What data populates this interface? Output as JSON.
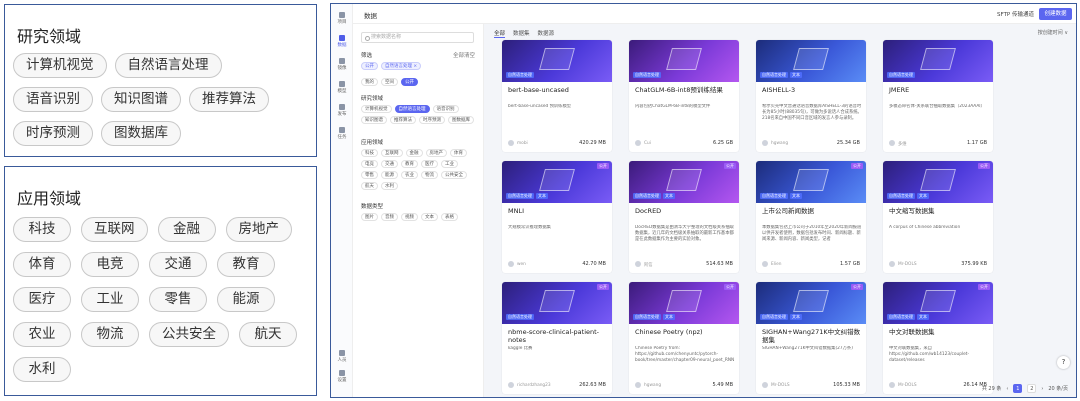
{
  "research": {
    "title": "研究领域",
    "tags": [
      "计算机视觉",
      "自然语言处理",
      "语音识别",
      "知识图谱",
      "推荐算法",
      "时序预测",
      "图数据库"
    ]
  },
  "application": {
    "title": "应用领域",
    "tags": [
      "科技",
      "互联网",
      "金融",
      "房地产",
      "体育",
      "电竞",
      "交通",
      "教育",
      "医疗",
      "工业",
      "零售",
      "能源",
      "农业",
      "物流",
      "公共安全",
      "航天",
      "水利"
    ]
  },
  "app": {
    "rail": [
      {
        "label": "项目",
        "icon": "folder-icon"
      },
      {
        "label": "数据",
        "icon": "database-icon",
        "active": true
      },
      {
        "label": "镜像",
        "icon": "image-icon"
      },
      {
        "label": "模型",
        "icon": "model-icon"
      },
      {
        "label": "发布",
        "icon": "publish-icon"
      },
      {
        "label": "任务",
        "icon": "task-icon"
      }
    ],
    "rail_bottom": [
      {
        "label": "人员",
        "icon": "people-icon"
      },
      {
        "label": "设置",
        "icon": "settings-icon"
      }
    ],
    "header": {
      "title": "数据",
      "sftp": "SFTP 传输通道",
      "create": "创建数据"
    },
    "filter": {
      "search_placeholder": "搜索数据名称",
      "filter_label": "筛选",
      "clear_label": "全部清空",
      "active": [
        "公开",
        "自然语言处理 ×"
      ],
      "scope": [
        {
          "label": "我的"
        },
        {
          "label": "空间"
        },
        {
          "label": "公开",
          "sel": true
        }
      ],
      "research_title": "研究领域",
      "research": [
        {
          "label": "计算机视觉"
        },
        {
          "label": "自然语言处理",
          "sel": true
        },
        {
          "label": "语音识别"
        },
        {
          "label": "知识图谱"
        },
        {
          "label": "推荐算法"
        },
        {
          "label": "时序预测"
        },
        {
          "label": "图数据库"
        }
      ],
      "app_title": "应用领域",
      "app": [
        "科技",
        "互联网",
        "金融",
        "房地产",
        "体育",
        "电竞",
        "交通",
        "教育",
        "医疗",
        "工业",
        "零售",
        "能源",
        "农业",
        "物流",
        "公共安全",
        "航天",
        "水利"
      ],
      "type_title": "数据类型",
      "types": [
        "图片",
        "音频",
        "视频",
        "文本",
        "表格"
      ]
    },
    "tabs": [
      "全部",
      "数据集",
      "数据源"
    ],
    "sort": "按创建时间 ∨",
    "cards": [
      {
        "name": "bert-base-uncased",
        "desc": "bert-base-uncased 预训练模型",
        "user": "mobi",
        "size": "420.29 MB",
        "badges": [
          "自然语言处理"
        ],
        "pub": "",
        "style": ""
      },
      {
        "name": "ChatGLM-6B-int8预训练结果",
        "desc": "内容包括ChatGLM-6B-int8的模型文件",
        "user": "Cui",
        "size": "6.25 GB",
        "badges": [
          "自然语言处理"
        ],
        "pub": "",
        "style": "img-pink"
      },
      {
        "name": "AISHELL-3",
        "desc": "希尔贝壳中文普通话语音数据库AISHELL-3的语音时长为85小时(88035句)，可做为多说话人合成系统。 218名来自中国不同口音区域的发言人参与录制。",
        "user": "hgwang",
        "size": "25.34 GB",
        "badges": [
          "自然语言处理",
          "文本"
        ],
        "pub": "",
        "style": "img-teal"
      },
      {
        "name": "JMERE",
        "desc": "多模态命名体-关系联合抽取数据集（2023AAAI）",
        "user": "多维",
        "size": "1.17 GB",
        "badges": [
          "自然语言处理"
        ],
        "pub": "",
        "style": ""
      },
      {
        "name": "MNLI",
        "desc": "大规模常识推理数据集",
        "user": "wen",
        "size": "42.70 MB",
        "badges": [
          "自然语言处理",
          "文本"
        ],
        "pub": "公开",
        "style": ""
      },
      {
        "name": "DocRED",
        "desc": "DocRED数据集是由清华大学整理的文档级关系抽取数据集，近几年的文档级关系抽取的最新工作基本都是在此数据集作为主要的实验对象。",
        "user": "阿信",
        "size": "514.63 MB",
        "badges": [
          "自然语言处理",
          "文本"
        ],
        "pub": "公开",
        "style": "img-pink"
      },
      {
        "name": "上市公司新闻数据",
        "desc": "本数据集包括上市公司于2010年至2020年新闻报道以供开发者使用，数据包括发布时间、新闻标题、新闻来源、新闻内容、新闻类型，记者",
        "user": "Elien",
        "size": "1.57 GB",
        "badges": [
          "自然语言处理",
          "文本"
        ],
        "pub": "公开",
        "style": "img-teal"
      },
      {
        "name": "中文缩写数据集",
        "desc": "A corpus of Chinese abbreviation",
        "user": "Mr-DOLS",
        "size": "375.99 KB",
        "badges": [
          "自然语言处理",
          "文本"
        ],
        "pub": "公开",
        "style": ""
      },
      {
        "name": "nbme-score-clinical-patient-notes",
        "desc": "kaggle 比赛",
        "user": "richardzhang23",
        "size": "262.63 MB",
        "badges": [
          "自然语言处理"
        ],
        "pub": "公开",
        "style": ""
      },
      {
        "name": "Chinese Poetry (npz)",
        "desc": "Chinese Poetry from: https://github.com/chenyuntc/pytorch-book/tree/master/chapter09-neural_poet_RNN",
        "user": "hgwang",
        "size": "5.49 MB",
        "badges": [
          "自然语言处理",
          "文本"
        ],
        "pub": "公开",
        "style": "img-pink"
      },
      {
        "name": "SIGHAN+Wang271K中文纠错数据集",
        "desc": "SIGHAN+Wang271K中文纠错数据集(27万条)",
        "user": "Mr-DOLS",
        "size": "105.33 MB",
        "badges": [
          "自然语言处理",
          "文本"
        ],
        "pub": "公开",
        "style": "img-teal"
      },
      {
        "name": "中文对联数据集",
        "desc": "中文对联数据集，来自 https://github.com/wb14123/couplet-dataset/releases",
        "user": "Mr-DOLS",
        "size": "26.14 MB",
        "badges": [
          "自然语言处理",
          "文本"
        ],
        "pub": "公开",
        "style": ""
      }
    ],
    "pager": {
      "total": "共 29 条",
      "pages": [
        "1",
        "2"
      ],
      "current": "1",
      "per": "20 条/页"
    }
  }
}
